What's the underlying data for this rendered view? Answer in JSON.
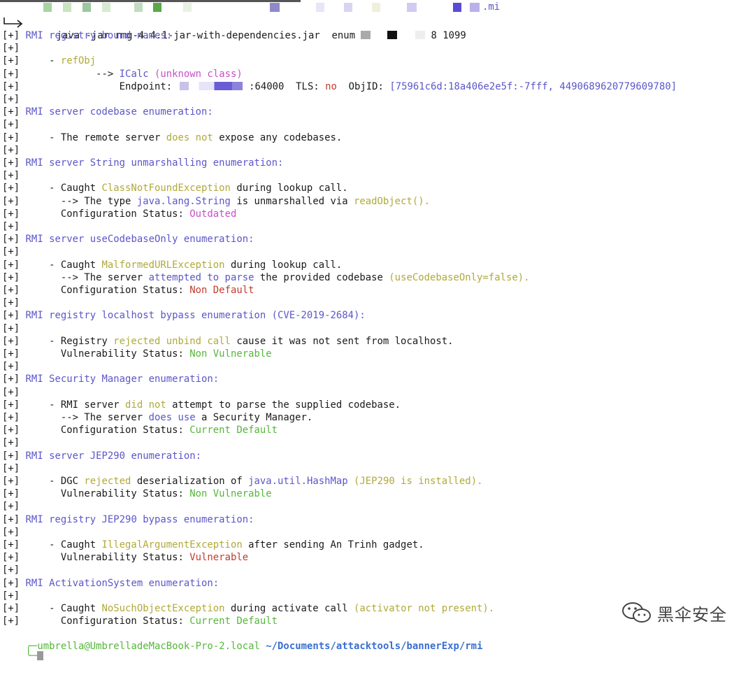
{
  "terminal": {
    "command": "java -jar rmg-4.4.1-jar-with-dependencies.jar  enum ",
    "command_port": "8 1099",
    "top_suffix": ".mi",
    "lines": [
      [
        [
          "p",
          "[+] "
        ],
        [
          "b",
          "RMI registry bound names:"
        ]
      ],
      [
        [
          "p",
          "[+]"
        ]
      ],
      [
        [
          "p",
          "[+]     - "
        ],
        [
          "y",
          "refObj"
        ]
      ],
      [
        [
          "p",
          "[+]             --> "
        ],
        [
          "b",
          "ICalc "
        ],
        [
          "m",
          "(unknown class)"
        ]
      ],
      [
        [
          "p",
          "[+]                 Endpoint:"
        ],
        [
          "blur",
          ""
        ],
        [
          "p",
          ":64000  TLS: "
        ],
        [
          "r",
          "no"
        ],
        [
          "p",
          "  ObjID: "
        ],
        [
          "b",
          "[75961c6d:18a406e2e5f:-7fff, 4490689620779609780]"
        ]
      ],
      [
        [
          "p",
          "[+]"
        ]
      ],
      [
        [
          "p",
          "[+] "
        ],
        [
          "b",
          "RMI server codebase enumeration:"
        ]
      ],
      [
        [
          "p",
          "[+]"
        ]
      ],
      [
        [
          "p",
          "[+]     - The remote server "
        ],
        [
          "y",
          "does not"
        ],
        [
          "p",
          " expose any codebases."
        ]
      ],
      [
        [
          "p",
          "[+]"
        ]
      ],
      [
        [
          "p",
          "[+] "
        ],
        [
          "b",
          "RMI server String unmarshalling enumeration:"
        ]
      ],
      [
        [
          "p",
          "[+]"
        ]
      ],
      [
        [
          "p",
          "[+]     - Caught "
        ],
        [
          "y",
          "ClassNotFoundException"
        ],
        [
          "p",
          " during lookup call."
        ]
      ],
      [
        [
          "p",
          "[+]       --> The type "
        ],
        [
          "b",
          "java.lang.String"
        ],
        [
          "p",
          " is unmarshalled via "
        ],
        [
          "y",
          "readObject()."
        ]
      ],
      [
        [
          "p",
          "[+]       Configuration Status: "
        ],
        [
          "m",
          "Outdated"
        ]
      ],
      [
        [
          "p",
          "[+]"
        ]
      ],
      [
        [
          "p",
          "[+] "
        ],
        [
          "b",
          "RMI server useCodebaseOnly enumeration:"
        ]
      ],
      [
        [
          "p",
          "[+]"
        ]
      ],
      [
        [
          "p",
          "[+]     - Caught "
        ],
        [
          "y",
          "MalformedURLException"
        ],
        [
          "p",
          " during lookup call."
        ]
      ],
      [
        [
          "p",
          "[+]       --> The server "
        ],
        [
          "b",
          "attempted to parse"
        ],
        [
          "p",
          " the provided codebase "
        ],
        [
          "y",
          "(useCodebaseOnly=false)."
        ]
      ],
      [
        [
          "p",
          "[+]       Configuration Status: "
        ],
        [
          "r",
          "Non Default"
        ]
      ],
      [
        [
          "p",
          "[+]"
        ]
      ],
      [
        [
          "p",
          "[+] "
        ],
        [
          "b",
          "RMI registry localhost bypass enumeration (CVE-2019-2684):"
        ]
      ],
      [
        [
          "p",
          "[+]"
        ]
      ],
      [
        [
          "p",
          "[+]     - Registry "
        ],
        [
          "y",
          "rejected unbind call"
        ],
        [
          "p",
          " cause it was not sent from localhost."
        ]
      ],
      [
        [
          "p",
          "[+]       Vulnerability Status: "
        ],
        [
          "g",
          "Non Vulnerable"
        ]
      ],
      [
        [
          "p",
          "[+]"
        ]
      ],
      [
        [
          "p",
          "[+] "
        ],
        [
          "b",
          "RMI Security Manager enumeration:"
        ]
      ],
      [
        [
          "p",
          "[+]"
        ]
      ],
      [
        [
          "p",
          "[+]     - RMI server "
        ],
        [
          "y",
          "did not"
        ],
        [
          "p",
          " attempt to parse the supplied codebase."
        ]
      ],
      [
        [
          "p",
          "[+]       --> The server "
        ],
        [
          "b",
          "does use"
        ],
        [
          "p",
          " a Security Manager."
        ]
      ],
      [
        [
          "p",
          "[+]       Configuration Status: "
        ],
        [
          "g",
          "Current Default"
        ]
      ],
      [
        [
          "p",
          "[+]"
        ]
      ],
      [
        [
          "p",
          "[+] "
        ],
        [
          "b",
          "RMI server JEP290 enumeration:"
        ]
      ],
      [
        [
          "p",
          "[+]"
        ]
      ],
      [
        [
          "p",
          "[+]     - DGC "
        ],
        [
          "y",
          "rejected"
        ],
        [
          "p",
          " deserialization of "
        ],
        [
          "b",
          "java.util.HashMap"
        ],
        [
          "p",
          " "
        ],
        [
          "y",
          "(JEP290 is installed)."
        ]
      ],
      [
        [
          "p",
          "[+]       Vulnerability Status: "
        ],
        [
          "g",
          "Non Vulnerable"
        ]
      ],
      [
        [
          "p",
          "[+]"
        ]
      ],
      [
        [
          "p",
          "[+] "
        ],
        [
          "b",
          "RMI registry JEP290 bypass enumeration:"
        ]
      ],
      [
        [
          "p",
          "[+]"
        ]
      ],
      [
        [
          "p",
          "[+]     - Caught "
        ],
        [
          "y",
          "IllegalArgumentException"
        ],
        [
          "p",
          " after sending An Trinh gadget."
        ]
      ],
      [
        [
          "p",
          "[+]       Vulnerability Status: "
        ],
        [
          "r",
          "Vulnerable"
        ]
      ],
      [
        [
          "p",
          "[+]"
        ]
      ],
      [
        [
          "p",
          "[+] "
        ],
        [
          "b",
          "RMI ActivationSystem enumeration:"
        ]
      ],
      [
        [
          "p",
          "[+]"
        ]
      ],
      [
        [
          "p",
          "[+]     - Caught "
        ],
        [
          "y",
          "NoSuchObjectException"
        ],
        [
          "p",
          " during activate call "
        ],
        [
          "y",
          "(activator not present)."
        ]
      ],
      [
        [
          "p",
          "[+]       Configuration Status: "
        ],
        [
          "g",
          "Current Default"
        ]
      ]
    ],
    "prompt_user": "umbrella@UmbrelladeMacBook-Pro-2.local",
    "prompt_path": "~/Documents/attacktools/bannerExp/rmi"
  },
  "watermark": {
    "text": "黑伞安全",
    "icon": "wechat-icon"
  },
  "colors": {
    "background": "#ffffff",
    "plain": "#1a1a1a",
    "blue": "#5b56c9",
    "yellow": "#b0a93a",
    "magenta": "#c94ec9",
    "red": "#c43b2d",
    "green": "#55b63a"
  }
}
